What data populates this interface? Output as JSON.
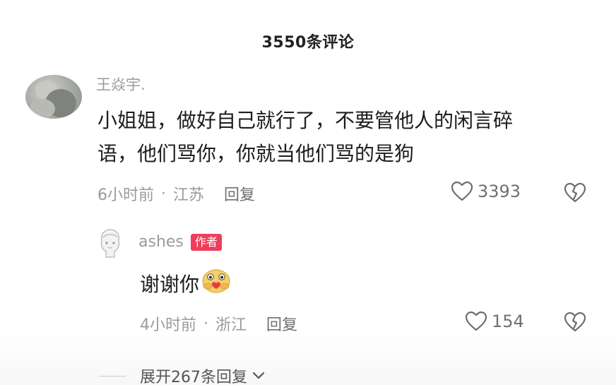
{
  "header": {
    "title": "3550条评论"
  },
  "comment": {
    "username": "王焱宇.",
    "text_line1": "小姐姐，做好自己就行了，不要管他人的闲言碎",
    "text_line2": "语，他们骂你，你就当他们骂的是狗",
    "time": "6小时前",
    "separator": "·",
    "location": "江苏",
    "reply_label": "回复",
    "like_count": "3393",
    "avatar_icon": "avatar-photo",
    "like_icon": "heart-outline-icon",
    "dislike_icon": "broken-heart-icon"
  },
  "reply": {
    "username": "ashes",
    "badge": "作者",
    "text": "谢谢你",
    "emoji": "hugging-heart-emoji",
    "time": "4小时前",
    "separator": "·",
    "location": "浙江",
    "reply_label": "回复",
    "like_count": "154",
    "like_icon": "heart-outline-icon",
    "dislike_icon": "broken-heart-icon"
  },
  "expand": {
    "label": "展开267条回复",
    "icon": "chevron-down-icon"
  },
  "colors": {
    "badge": "#ef3e5c",
    "text_primary": "#1c1c1c",
    "text_secondary": "#9a9a9a"
  }
}
